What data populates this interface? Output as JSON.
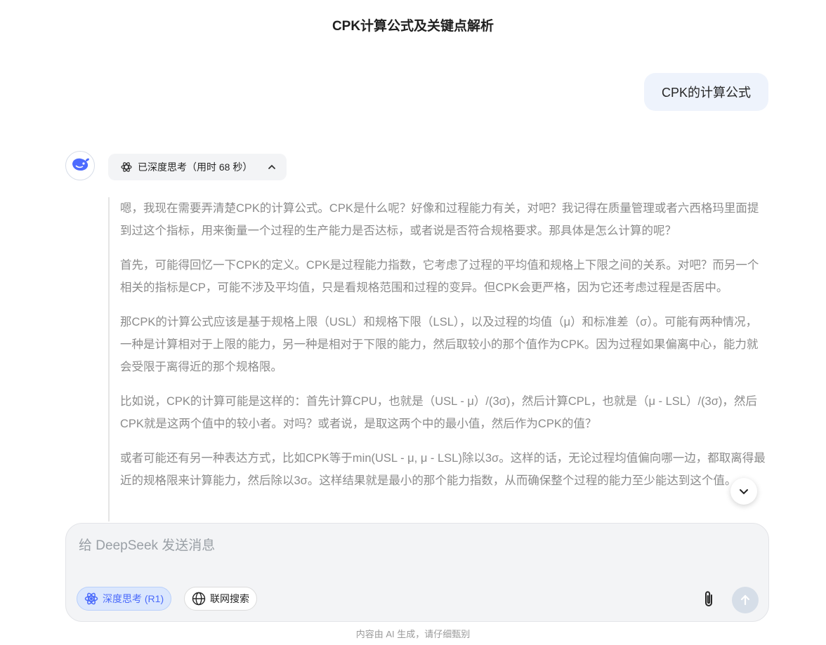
{
  "header": {
    "title": "CPK计算公式及关键点解析"
  },
  "user_message": {
    "text": "CPK的计算公式"
  },
  "assistant": {
    "avatar_icon": "deepseek-whale-icon",
    "think_chip": {
      "icon": "atom-icon",
      "label": "已深度思考（用时 68 秒）",
      "toggle_icon": "chevron-up-icon"
    },
    "thought_paragraphs": [
      "嗯，我现在需要弄清楚CPK的计算公式。CPK是什么呢？好像和过程能力有关，对吧？我记得在质量管理或者六西格玛里面提到过这个指标，用来衡量一个过程的生产能力是否达标，或者说是否符合规格要求。那具体是怎么计算的呢？",
      "首先，可能得回忆一下CPK的定义。CPK是过程能力指数，它考虑了过程的平均值和规格上下限之间的关系。对吧？而另一个相关的指标是CP，可能不涉及平均值，只是看规格范围和过程的变异。但CPK会更严格，因为它还考虑过程是否居中。",
      "那CPK的计算公式应该是基于规格上限（USL）和规格下限（LSL），以及过程的均值（μ）和标准差（σ）。可能有两种情况，一种是计算相对于上限的能力，另一种是相对于下限的能力，然后取较小的那个值作为CPK。因为过程如果偏离中心，能力就会受限于离得近的那个规格限。",
      "比如说，CPK的计算可能是这样的：首先计算CPU，也就是（USL - μ）/(3σ)，然后计算CPL，也就是（μ - LSL）/(3σ)，然后CPK就是这两个值中的较小者。对吗？或者说，是取这两个中的最小值，然后作为CPK的值？",
      "或者可能还有另一种表达方式，比如CPK等于min(USL - μ, μ - LSL)除以3σ。这样的话，无论过程均值偏向哪一边，都取离得最近的规格限来计算能力，然后除以3σ。这样结果就是最小的那个能力指数，从而确保整个过程的能力至少能达到这个值。"
    ]
  },
  "scroll_button": {
    "icon": "chevron-down-icon"
  },
  "composer": {
    "placeholder": "给 DeepSeek 发送消息",
    "value": "",
    "deep_think": {
      "icon": "atom-icon",
      "label": "深度思考 (R1)",
      "active": true
    },
    "web_search": {
      "icon": "globe-icon",
      "label": "联网搜索",
      "active": false
    },
    "attach_icon": "paperclip-icon",
    "send_icon": "arrow-up-icon"
  },
  "footer": {
    "disclaimer": "内容由 AI 生成，请仔细甄别"
  },
  "colors": {
    "accent": "#4b6bfb",
    "bubble": "#eef3fc",
    "send_disabled": "#d6dee8"
  }
}
